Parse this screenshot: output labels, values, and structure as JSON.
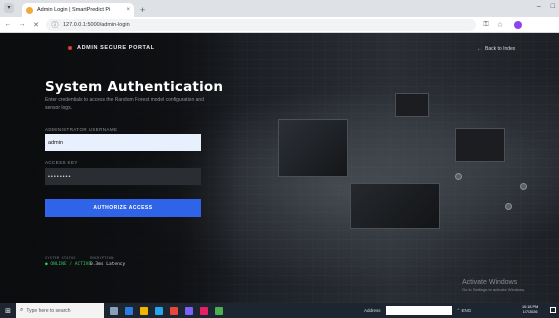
{
  "browser": {
    "tab_title": "Admin Login | SmartPredict Pi",
    "tab_close": "×",
    "new_tab": "+",
    "url": "127.0.0.1:5000/admin-login",
    "window_controls": [
      "–",
      "□"
    ]
  },
  "header": {
    "brand": "ADMIN SECURE PORTAL",
    "back_link": "Back to Index",
    "back_arrow": "←"
  },
  "main": {
    "title": "System Authentication",
    "subtitle": "Enter credentials to access the Random Forest model configuration and sensor logs.",
    "username_label": "ADMINISTRATOR USERNAME",
    "username_value": "admin",
    "key_label": "ACCESS KEY",
    "key_value": "••••••••",
    "submit_label": "AUTHORIZE ACCESS"
  },
  "status": [
    {
      "key": "SYSTEM STATUS",
      "value": "● ONLINE / ACTIVE"
    },
    {
      "key": "ENCRYPTION",
      "value": "0.3ms Latency"
    }
  ],
  "watermark": {
    "line1": "Activate Windows",
    "line2": "Go to Settings to activate Windows."
  },
  "taskbar": {
    "search_placeholder": "Type here to search",
    "address_label": "Address",
    "tray_text": "⌃ ENG",
    "clock_time": "10:18 PM",
    "clock_date": "1/7/2026"
  },
  "colors": {
    "accent": "#2f63e8",
    "status_green": "#34c759",
    "brand_dot": "#e53935"
  }
}
